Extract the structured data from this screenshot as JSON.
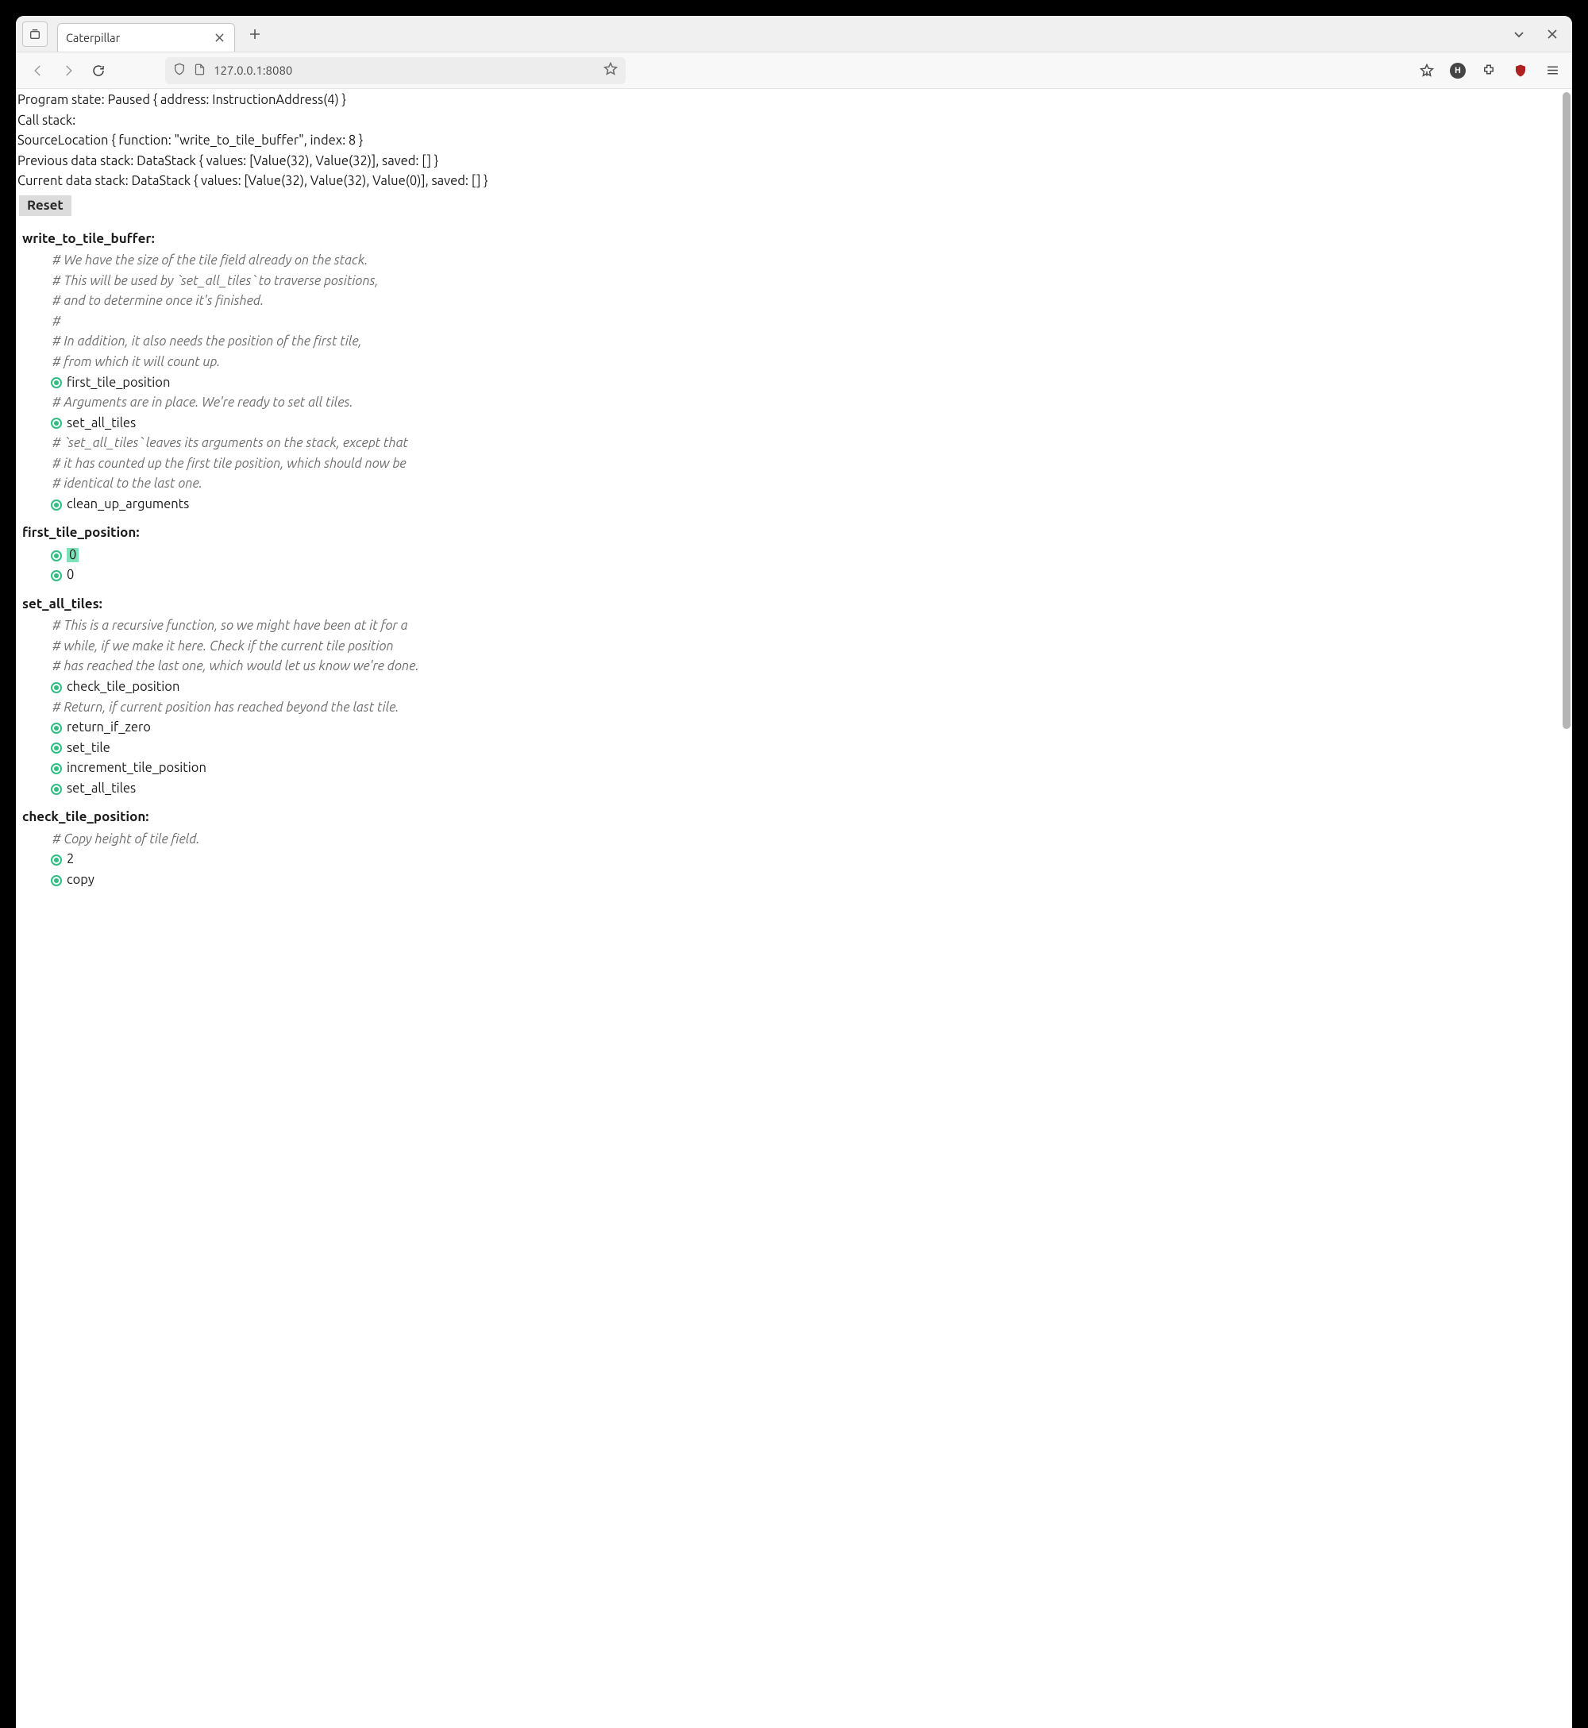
{
  "browser": {
    "tab_title": "Caterpillar",
    "url": "127.0.0.1:8080"
  },
  "state": {
    "program_state": "Program state: Paused { address: InstructionAddress(4) }",
    "call_stack_label": "Call stack:",
    "source_location": "SourceLocation { function: \"write_to_tile_buffer\", index: 8 }",
    "prev_stack": "Previous data stack: DataStack { values: [Value(32), Value(32)], saved: [] }",
    "curr_stack": "Current data stack: DataStack { values: [Value(32), Value(32), Value(0)], saved: [] }",
    "reset_label": "Reset"
  },
  "functions": [
    {
      "name": "write_to_tile_buffer:",
      "lines": [
        {
          "kind": "comment",
          "text": "# We have the size of the tile field already on the stack."
        },
        {
          "kind": "comment",
          "text": "# This will be used by `set_all_tiles` to traverse positions,"
        },
        {
          "kind": "comment",
          "text": "# and to determine once it's finished."
        },
        {
          "kind": "comment",
          "text": "#"
        },
        {
          "kind": "comment",
          "text": "# In addition, it also needs the position of the first tile,"
        },
        {
          "kind": "comment",
          "text": "# from which it will count up."
        },
        {
          "kind": "instr",
          "text": "first_tile_position"
        },
        {
          "kind": "comment",
          "text": "# Arguments are in place. We're ready to set all tiles."
        },
        {
          "kind": "instr",
          "text": "set_all_tiles"
        },
        {
          "kind": "comment",
          "text": "# `set_all_tiles` leaves its arguments on the stack, except that"
        },
        {
          "kind": "comment",
          "text": "# it has counted up the first tile position, which should now be"
        },
        {
          "kind": "comment",
          "text": "# identical to the last one."
        },
        {
          "kind": "instr",
          "text": "clean_up_arguments"
        }
      ]
    },
    {
      "name": "first_tile_position:",
      "lines": [
        {
          "kind": "instr",
          "text": "0",
          "highlight": true
        },
        {
          "kind": "instr",
          "text": "0"
        }
      ]
    },
    {
      "name": "set_all_tiles:",
      "lines": [
        {
          "kind": "comment",
          "text": "# This is a recursive function, so we might have been at it for a"
        },
        {
          "kind": "comment",
          "text": "# while, if we make it here. Check if the current tile position"
        },
        {
          "kind": "comment",
          "text": "# has reached the last one, which would let us know we're done."
        },
        {
          "kind": "instr",
          "text": "check_tile_position"
        },
        {
          "kind": "comment",
          "text": "# Return, if current position has reached beyond the last tile."
        },
        {
          "kind": "instr",
          "text": "return_if_zero"
        },
        {
          "kind": "instr",
          "text": "set_tile"
        },
        {
          "kind": "instr",
          "text": "increment_tile_position"
        },
        {
          "kind": "instr",
          "text": "set_all_tiles"
        }
      ]
    },
    {
      "name": "check_tile_position:",
      "lines": [
        {
          "kind": "comment",
          "text": "# Copy height of tile field."
        },
        {
          "kind": "instr",
          "text": "2"
        },
        {
          "kind": "instr",
          "text": "copy"
        }
      ]
    }
  ]
}
